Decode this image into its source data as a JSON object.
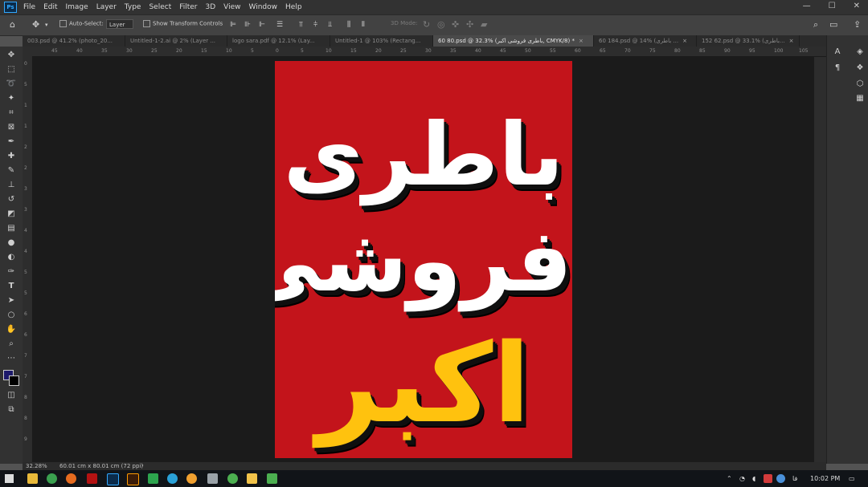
{
  "app": {
    "logo_text": "Ps"
  },
  "menu": [
    "File",
    "Edit",
    "Image",
    "Layer",
    "Type",
    "Select",
    "Filter",
    "3D",
    "View",
    "Window",
    "Help"
  ],
  "window_controls": {
    "minimize": "—",
    "maximize": "☐",
    "close": "✕"
  },
  "options": {
    "auto_select_label": "Auto-Select:",
    "layer_select_value": "Layer",
    "show_transform_label": "Show Transform Controls",
    "mode_3d_label": "3D Mode:"
  },
  "tabs": [
    {
      "label": "003.psd @ 41.2% (photo_20..."
    },
    {
      "label": "Untitled-1-2.ai @ 2% (Layer ..."
    },
    {
      "label": "logo sara.pdf @ 12.1% (Lay..."
    },
    {
      "label": "Untitled-1 @ 103% (Rectang..."
    },
    {
      "label": "60 80.psd @ 32.3% (باطری فروشی اکبر, CMYK/8) *"
    },
    {
      "label": "60 184.psd @ 14% (باطری ..."
    },
    {
      "label": "152 62.psd @ 33.1% (باطری..."
    }
  ],
  "tab_close": "×",
  "ruler_h": [
    "45",
    "40",
    "35",
    "30",
    "25",
    "20",
    "15",
    "10",
    "5",
    "0",
    "5",
    "10",
    "15",
    "20",
    "25",
    "30",
    "35",
    "40",
    "45",
    "50",
    "55",
    "60",
    "65",
    "70",
    "75",
    "80",
    "85",
    "90",
    "95",
    "100",
    "105"
  ],
  "ruler_v": [
    "0",
    "5",
    "1",
    "1",
    "2",
    "2",
    "3",
    "3",
    "4",
    "4",
    "5",
    "5",
    "6",
    "6",
    "7",
    "7",
    "8",
    "8",
    "9"
  ],
  "document": {
    "line1": "باطری",
    "line2": "فروشی",
    "line3": "اکبر"
  },
  "colors": {
    "poster_bg": "#c3141b",
    "text_white": "#ffffff",
    "text_yellow": "#ffc20e",
    "foreground_swatch": "#1d1a6b",
    "background_swatch": "#000000"
  },
  "status": {
    "zoom": "32.28%",
    "doc_info": "60.01 cm x 80.01 cm (72 ppi)",
    "arrow": "›"
  },
  "taskbar": {
    "lang": "فا",
    "time": "10:02 PM"
  }
}
